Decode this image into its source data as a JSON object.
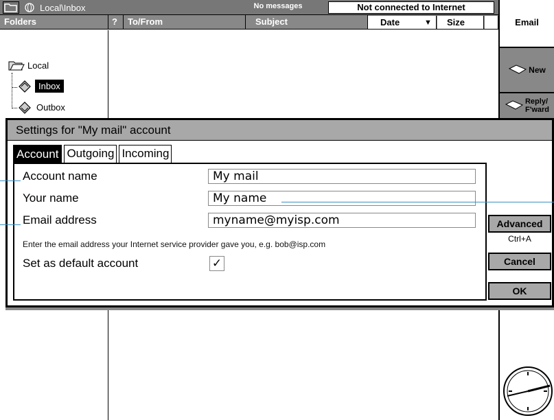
{
  "titlebar": {
    "path": "Local\\Inbox",
    "status": "No messages",
    "connection": "Not connected to Internet"
  },
  "columns": {
    "folders": "Folders",
    "flag": "?",
    "to_from": "To/From",
    "subject": "Subject",
    "date": "Date",
    "sort_arrow": "▼",
    "size": "Size"
  },
  "folders": {
    "root": "Local",
    "inbox": "Inbox",
    "outbox": "Outbox"
  },
  "side": {
    "title": "Email",
    "new": "New",
    "reply": "Reply/\nF'ward"
  },
  "dialog": {
    "title": "Settings for \"My mail\" account",
    "tabs": [
      "Account",
      "Outgoing",
      "Incoming"
    ],
    "account_name_label": "Account name",
    "account_name_value": "My mail",
    "your_name_label": "Your name",
    "your_name_value": "My name",
    "email_label": "Email address",
    "email_value": "myname@myisp.com",
    "hint": "Enter the email address your Internet service provider gave you, e.g. bob@isp.com",
    "default_label": "Set as default account",
    "default_check": "✓",
    "advanced": "Advanced",
    "advanced_shortcut": "Ctrl+A",
    "cancel": "Cancel",
    "ok": "OK"
  },
  "icons": [
    "folder-open-icon",
    "globe-icon",
    "inbox-icon",
    "outbox-icon",
    "new-mail-icon",
    "reply-icon",
    "clock-icon"
  ],
  "colors": {
    "titlebar": "#777777",
    "header": "#888888",
    "callout": "#3a8fc4",
    "button": "#a8a8a8"
  }
}
